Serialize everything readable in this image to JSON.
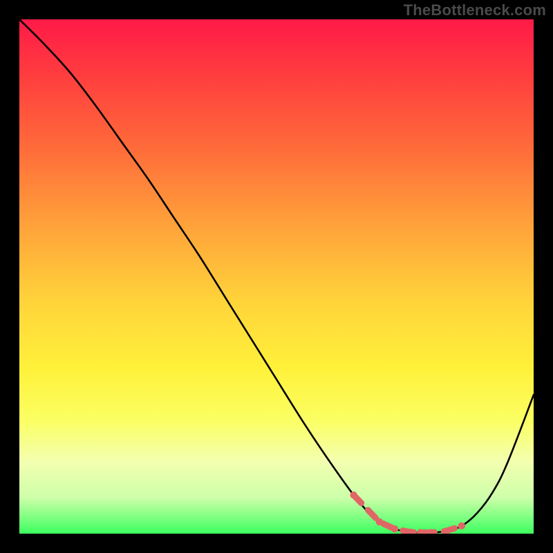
{
  "watermark": "TheBottleneck.com",
  "colors": {
    "frame": "#000000",
    "gradient_top": "#ff1a48",
    "gradient_bottom": "#3cff5f",
    "curve": "#000000",
    "marker": "#e06666"
  },
  "chart_data": {
    "type": "line",
    "title": "",
    "xlabel": "",
    "ylabel": "",
    "xlim": [
      0,
      100
    ],
    "ylim": [
      0,
      100
    ],
    "grid": false,
    "legend": false,
    "annotations": [],
    "series": [
      {
        "name": "bottleneck-curve",
        "x": [
          0,
          5,
          10,
          15,
          20,
          25,
          30,
          35,
          40,
          45,
          50,
          55,
          60,
          65,
          68,
          70,
          73,
          76,
          78,
          80,
          83,
          86,
          89,
          92,
          95,
          100
        ],
        "y": [
          100,
          95,
          89.5,
          83,
          76,
          69,
          61.5,
          54,
          46,
          38,
          30,
          22,
          14.5,
          7.5,
          4,
          2.3,
          0.9,
          0.3,
          0.2,
          0.2,
          0.5,
          1.5,
          4,
          8,
          14,
          27
        ]
      }
    ],
    "markers": {
      "name": "highlighted-points",
      "x": [
        65,
        70,
        73,
        76,
        78,
        80,
        83,
        86
      ],
      "y": [
        7.5,
        2.3,
        0.9,
        0.3,
        0.2,
        0.2,
        0.5,
        1.5
      ]
    }
  }
}
